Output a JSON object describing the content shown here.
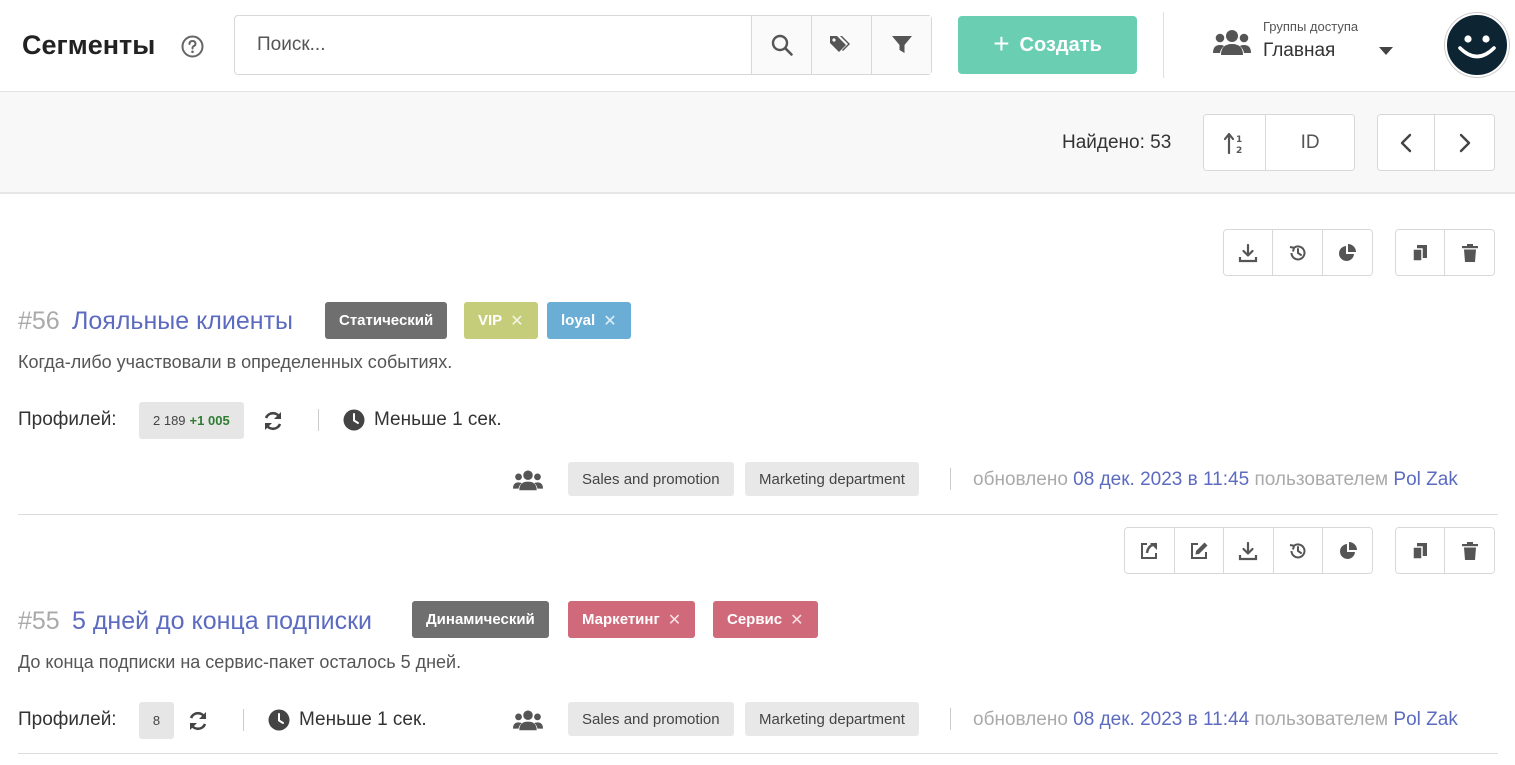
{
  "header": {
    "title": "Сегменты",
    "search_placeholder": "Поиск...",
    "create_label": "Создать",
    "groups_label": "Группы доступа",
    "groups_value": "Главная"
  },
  "toolbar": {
    "found_text": "Найдено: 53",
    "sort_field": "ID"
  },
  "colors": {
    "accent": "#6acfb2",
    "link": "#5c6bc0",
    "badge_type": "#6f6f6f",
    "badge_vip": "#c5cd7a",
    "badge_loyal": "#6aaed6",
    "badge_red": "#d06a7a"
  },
  "segments": [
    {
      "id": "#56",
      "name": "Лояльные клиенты",
      "type": "Статический",
      "tags": [
        "VIP",
        "loyal"
      ],
      "description": "Когда-либо участвовали в определенных событиях.",
      "profiles_label": "Профилей:",
      "count": "2 189",
      "count_delta": "+1 005",
      "duration": "Меньше 1 сек.",
      "departments": [
        "Sales and promotion",
        "Marketing department"
      ],
      "updated_prefix": "обновлено",
      "updated_date": "08 дек. 2023 в 11:45",
      "updated_by_prefix": "пользователем",
      "updated_user": "Pol Zak"
    },
    {
      "id": "#55",
      "name": "5 дней до конца подписки",
      "type": "Динамический",
      "tags": [
        "Маркетинг",
        "Сервис"
      ],
      "description": "До конца подписки на сервис-пакет осталось 5 дней.",
      "profiles_label": "Профилей:",
      "count": "8",
      "duration": "Меньше 1 сек.",
      "departments": [
        "Sales and promotion",
        "Marketing department"
      ],
      "updated_prefix": "обновлено",
      "updated_date": "08 дек. 2023 в 11:44",
      "updated_by_prefix": "пользователем",
      "updated_user": "Pol Zak"
    }
  ]
}
